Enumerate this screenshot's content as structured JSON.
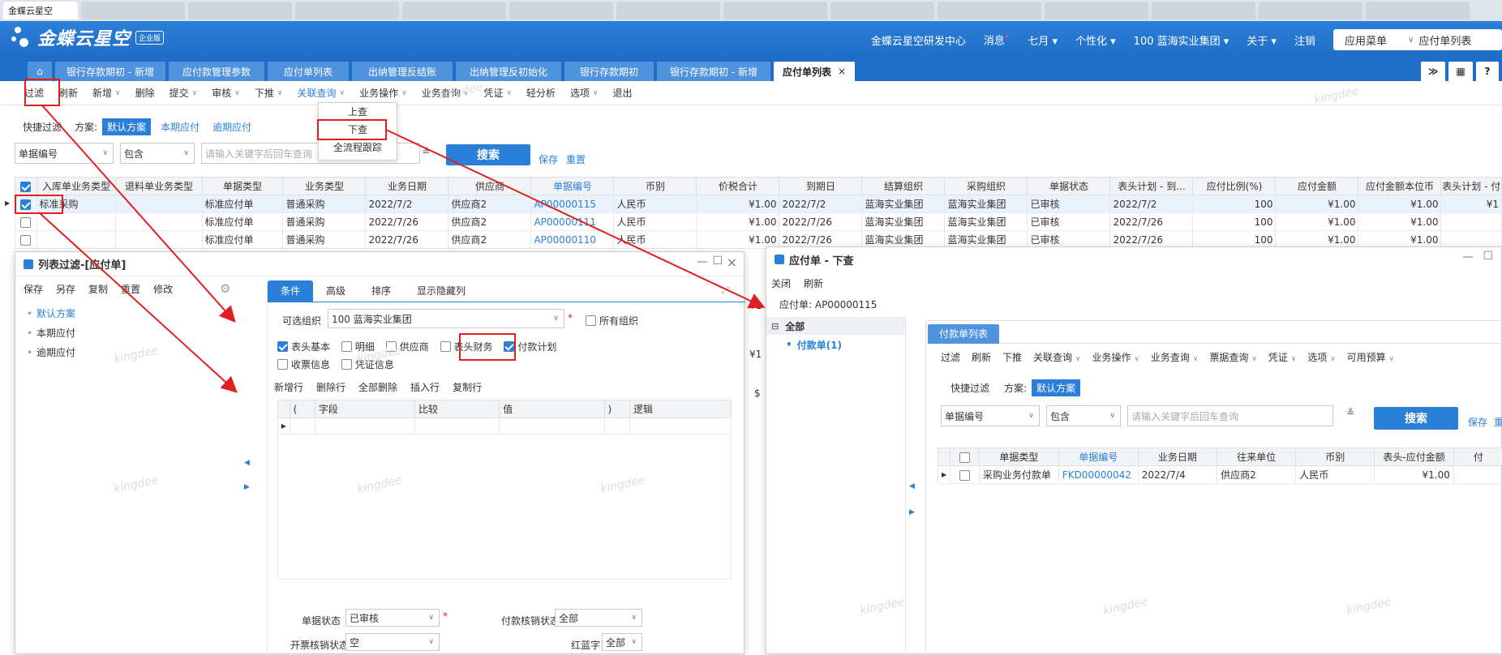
{
  "browser_tabs": [
    "金蝶云星空",
    "",
    "",
    "",
    "",
    "",
    "",
    "",
    "",
    "",
    "",
    "",
    "",
    ""
  ],
  "header": {
    "brand": "金蝶云星空",
    "edition": "企业版",
    "org_center": "金蝶云星空研发中心",
    "messages": "消息",
    "month": "七月",
    "personalize": "个性化",
    "org": "100  蓝海实业集团",
    "about": "关于",
    "logout": "注销",
    "app_menu": "应用菜单",
    "app_menu_value": "应付单列表"
  },
  "page_tabs": [
    "银行存款期初 - 新增",
    "应付款管理参数",
    "应付单列表",
    "出纳管理反结账",
    "出纳管理反初始化",
    "银行存款期初",
    "银行存款期初 - 新增",
    "应付单列表"
  ],
  "toolbar": {
    "filter": "过滤",
    "refresh": "刷新",
    "new": "新增",
    "delete": "删除",
    "submit": "提交",
    "audit": "审核",
    "push": "下推",
    "assoc": "关联查询",
    "biz_op": "业务操作",
    "biz_query": "业务查询",
    "voucher": "凭证",
    "light_analysis": "轻分析",
    "options": "选项",
    "exit": "退出"
  },
  "assoc_menu": [
    "上查",
    "下查",
    "全流程跟踪"
  ],
  "quick_filter": {
    "label": "快捷过滤",
    "scheme_label": "方案:",
    "default": "默认方案",
    "current": "本期应付",
    "overdue": "逾期应付",
    "field": "单据编号",
    "op": "包含",
    "placeholder": "请输入关键字后回车查询",
    "search": "搜索",
    "save": "保存",
    "reset": "重置"
  },
  "main_grid": {
    "columns": [
      "入库单业务类型",
      "退料单业务类型",
      "单据类型",
      "业务类型",
      "业务日期",
      "供应商",
      "单据编号",
      "币别",
      "价税合计",
      "到期日",
      "结算组织",
      "采购组织",
      "单据状态",
      "表头计划 - 到...",
      "应付比例(%)",
      "应付金额",
      "应付金额本位币",
      "表头计划 - 付"
    ],
    "rows": [
      {
        "checked": true,
        "cells": [
          "标准采购",
          "",
          "标准应付单",
          "普通采购",
          "2022/7/2",
          "供应商2",
          "AP00000115",
          "人民币",
          "¥1.00",
          "2022/7/2",
          "蓝海实业集团",
          "蓝海实业集团",
          "已审核",
          "2022/7/2",
          "100",
          "¥1.00",
          "¥1.00",
          "¥1"
        ]
      },
      {
        "checked": false,
        "cells": [
          "",
          "",
          "标准应付单",
          "普通采购",
          "2022/7/26",
          "供应商2",
          "AP00000111",
          "人民币",
          "¥1.00",
          "2022/7/26",
          "蓝海实业集团",
          "蓝海实业集团",
          "已审核",
          "2022/7/26",
          "100",
          "¥1.00",
          "¥1.00",
          ""
        ]
      },
      {
        "checked": false,
        "cells": [
          "",
          "",
          "标准应付单",
          "普通采购",
          "2022/7/26",
          "供应商2",
          "AP00000110",
          "人民币",
          "¥1.00",
          "2022/7/26",
          "蓝海实业集团",
          "蓝海实业集团",
          "已审核",
          "2022/7/26",
          "100",
          "¥1.00",
          "¥1.00",
          ""
        ]
      }
    ]
  },
  "filter_dialog": {
    "title": "列表过滤-[应付单]",
    "actions": [
      "保存",
      "另存",
      "复制",
      "重置",
      "修改"
    ],
    "schemes": [
      "默认方案",
      "本期应付",
      "逾期应付"
    ],
    "tabs": [
      "条件",
      "高级",
      "排序",
      "显示隐藏列"
    ],
    "org_label": "可选组织",
    "org_value": "100 蓝海实业集团",
    "all_orgs": "所有组织",
    "checks": [
      {
        "label": "表头基本",
        "on": true
      },
      {
        "label": "明细",
        "on": false
      },
      {
        "label": "供应商",
        "on": false
      },
      {
        "label": "表头财务",
        "on": false
      },
      {
        "label": "付款计划",
        "on": true
      },
      {
        "label": "收票信息",
        "on": false
      },
      {
        "label": "凭证信息",
        "on": false
      }
    ],
    "row_actions": [
      "新增行",
      "删除行",
      "全部删除",
      "插入行",
      "复制行"
    ],
    "cond_columns": [
      "(",
      "字段",
      "比较",
      "值",
      ")",
      "逻辑"
    ],
    "doc_status_label": "单据状态",
    "doc_status": "已审核",
    "pay_verify_label": "付款核销状态",
    "pay_verify": "全部",
    "invoice_verify_label": "开票核销状态",
    "invoice_verify": "空",
    "red_blue_label": "红蓝字",
    "red_blue": "全部",
    "peek_values": [
      "¥1",
      "¥1",
      "$"
    ]
  },
  "downstream_dialog": {
    "title": "应付单 - 下查",
    "close": "关闭",
    "refresh": "刷新",
    "doc_line": "应付单: AP00000115",
    "tree_root": "全部",
    "tree_child": "付款单(1)",
    "inner_tab": "付款单列表",
    "inner_toolbar": [
      "过滤",
      "刷新",
      "下推",
      "关联查询",
      "业务操作",
      "业务查询",
      "票据查询",
      "凭证",
      "选项",
      "可用预算"
    ],
    "quick_label": "快捷过滤",
    "scheme_label": "方案:",
    "scheme": "默认方案",
    "field": "单据编号",
    "op": "包含",
    "placeholder": "请输入关键字后回车查询",
    "search": "搜索",
    "save": "保存",
    "reset": "重",
    "columns": [
      "单据类型",
      "单据编号",
      "业务日期",
      "往来单位",
      "币别",
      "表头-应付金额",
      "付"
    ],
    "row": [
      "采购业务付款单",
      "FKD00000042",
      "2022/7/4",
      "供应商2",
      "人民币",
      "¥1.00",
      ""
    ]
  },
  "watermark": "kingdee",
  "colors": {
    "brand": "#1f6dc6",
    "accent": "#2a7fd9",
    "highlight": "#e02020"
  }
}
